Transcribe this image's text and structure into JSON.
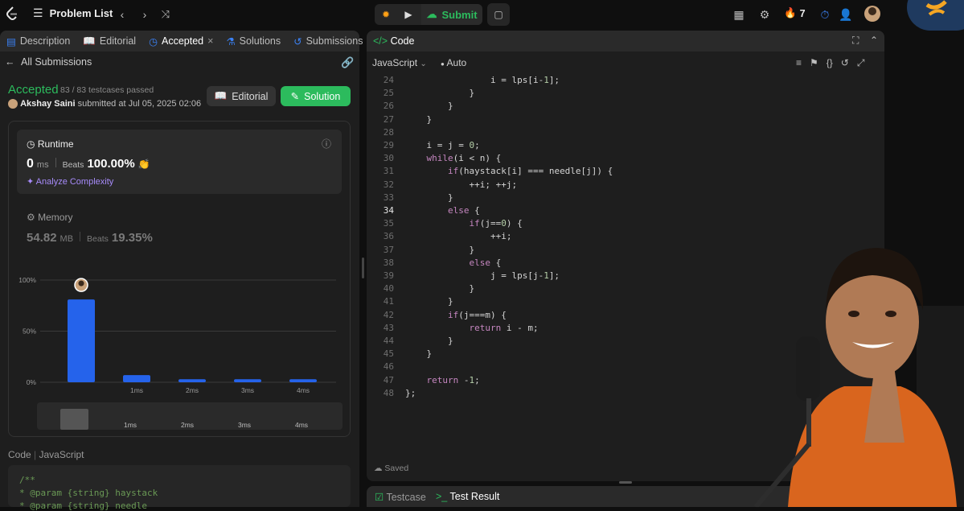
{
  "topbar": {
    "problem_list": "Problem List",
    "submit": "Submit",
    "streak": "7"
  },
  "tabs": [
    {
      "label": "Description"
    },
    {
      "label": "Editorial"
    },
    {
      "label": "Accepted"
    },
    {
      "label": "Solutions"
    },
    {
      "label": "Submissions"
    }
  ],
  "submission": {
    "back_label": "All Submissions",
    "status": "Accepted",
    "testcases": "83 / 83 testcases passed",
    "author": "Akshay Saini",
    "submitted_text": "submitted at Jul 05, 2025 02:06",
    "editorial_button": "Editorial",
    "solution_button": "Solution"
  },
  "runtime": {
    "title": "Runtime",
    "value": "0",
    "unit": "ms",
    "beats_label": "Beats",
    "beats": "100.00%",
    "analyze": "Analyze Complexity"
  },
  "memory": {
    "title": "Memory",
    "value": "54.82",
    "unit": "MB",
    "beats_label": "Beats",
    "beats": "19.35%"
  },
  "chart_data": {
    "type": "bar",
    "y_ticks": [
      "100%",
      "50%",
      "0%"
    ],
    "ylim": [
      0,
      100
    ],
    "categories": [
      "0ms",
      "1ms",
      "2ms",
      "3ms",
      "4ms"
    ],
    "x_tick_labels": [
      "",
      "1ms",
      "2ms",
      "3ms",
      "4ms"
    ],
    "values": [
      81,
      7,
      3,
      3,
      3
    ],
    "highlight_index": 0,
    "bar_color": "#2563eb"
  },
  "scrubber_labels": [
    "1ms",
    "2ms",
    "3ms",
    "4ms"
  ],
  "code_preview": {
    "label_code": "Code",
    "label_lang": "JavaScript",
    "lines": [
      "/**",
      " * @param {string} haystack",
      " * @param {string} needle"
    ]
  },
  "editor": {
    "title": "Code",
    "language": "JavaScript",
    "mode": "Auto",
    "saved": "Saved",
    "current_line": 34,
    "lines": [
      {
        "n": 24,
        "t": "                i = lps[i-1];"
      },
      {
        "n": 25,
        "t": "            }"
      },
      {
        "n": 26,
        "t": "        }"
      },
      {
        "n": 27,
        "t": "    }"
      },
      {
        "n": 28,
        "t": ""
      },
      {
        "n": 29,
        "t": "    i = j = 0;"
      },
      {
        "n": 30,
        "t": "    while(i < n) {"
      },
      {
        "n": 31,
        "t": "        if(haystack[i] === needle[j]) {"
      },
      {
        "n": 32,
        "t": "            ++i; ++j;"
      },
      {
        "n": 33,
        "t": "        }"
      },
      {
        "n": 34,
        "t": "        else {"
      },
      {
        "n": 35,
        "t": "            if(j==0) {"
      },
      {
        "n": 36,
        "t": "                ++i;"
      },
      {
        "n": 37,
        "t": "            }"
      },
      {
        "n": 38,
        "t": "            else {"
      },
      {
        "n": 39,
        "t": "                j = lps[j-1];"
      },
      {
        "n": 40,
        "t": "            }"
      },
      {
        "n": 41,
        "t": "        }"
      },
      {
        "n": 42,
        "t": "        if(j===m) {"
      },
      {
        "n": 43,
        "t": "            return i - m;"
      },
      {
        "n": 44,
        "t": "        }"
      },
      {
        "n": 45,
        "t": "    }"
      },
      {
        "n": 46,
        "t": ""
      },
      {
        "n": 47,
        "t": "    return -1;"
      },
      {
        "n": 48,
        "t": "};"
      }
    ]
  },
  "bottom_tabs": {
    "testcase": "Testcase",
    "test_result": "Test Result"
  },
  "colors": {
    "accent_green": "#2cbb5d",
    "bar_blue": "#2563eb",
    "orange": "#ffa116"
  }
}
